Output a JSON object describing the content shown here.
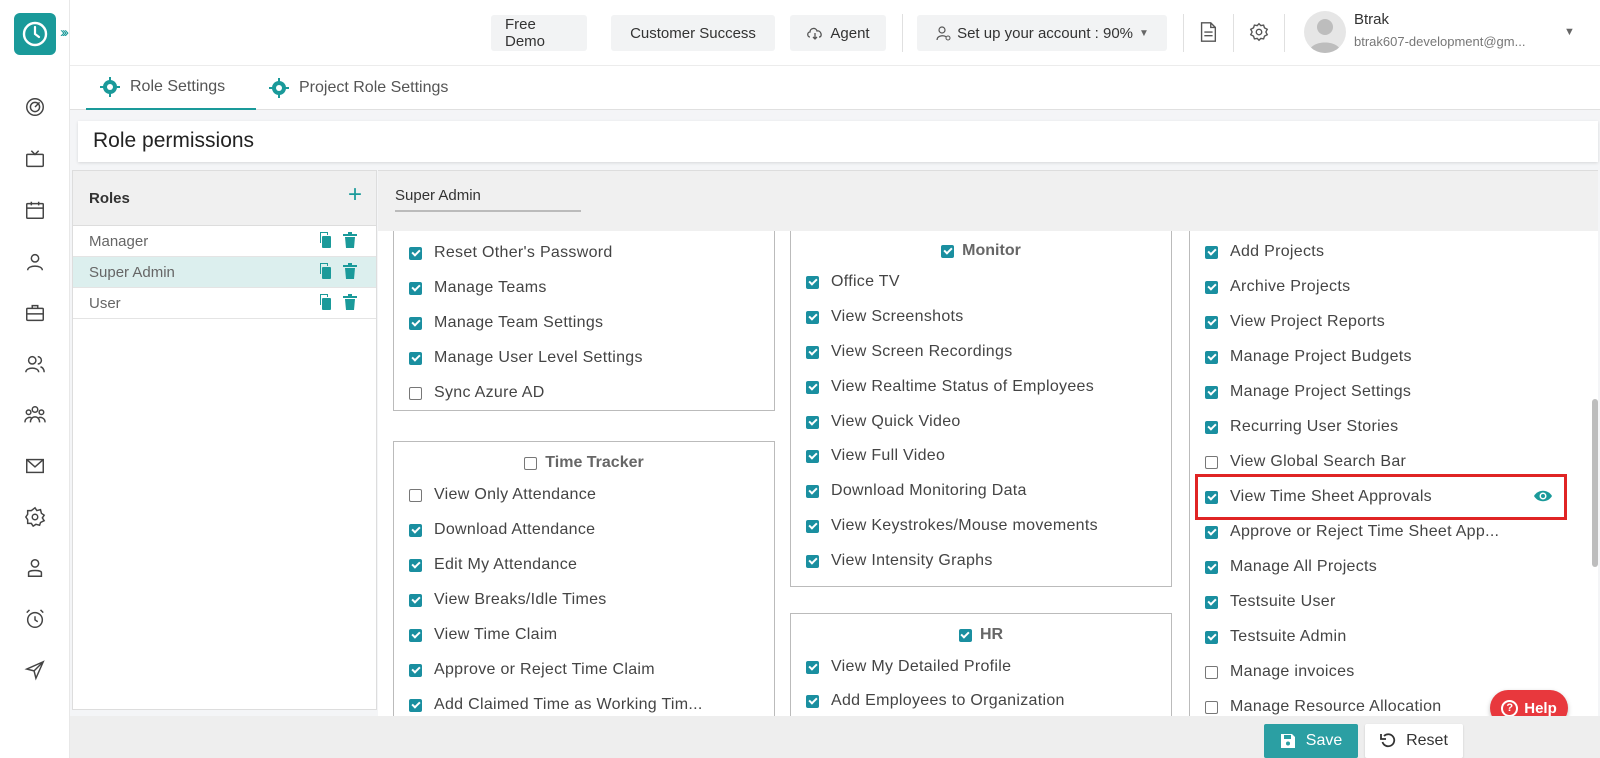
{
  "topbar": {
    "free_demo": "Free Demo",
    "customer_success": "Customer Success",
    "agent": "Agent",
    "setup": "Set up your account : 90%",
    "user_name": "Btrak",
    "user_email": "btrak607-development@gm..."
  },
  "tabs": {
    "role_settings": "Role Settings",
    "project_role_settings": "Project Role Settings"
  },
  "page_title": "Role permissions",
  "roles": {
    "header": "Roles",
    "items": [
      "Manager",
      "Super Admin",
      "User"
    ],
    "selected": "Super Admin"
  },
  "perm": {
    "role_name": "Super Admin",
    "col1_top": [
      {
        "label": "Reset Other's Password",
        "checked": true
      },
      {
        "label": "Manage Teams",
        "checked": true
      },
      {
        "label": "Manage Team Settings",
        "checked": true
      },
      {
        "label": "Manage User Level Settings",
        "checked": true
      },
      {
        "label": "Sync Azure AD",
        "checked": false
      }
    ],
    "time_tracker": {
      "title": "Time Tracker",
      "checked": false,
      "items": [
        {
          "label": "View Only Attendance",
          "checked": false
        },
        {
          "label": "Download Attendance",
          "checked": true
        },
        {
          "label": "Edit My Attendance",
          "checked": true
        },
        {
          "label": "View Breaks/Idle Times",
          "checked": true
        },
        {
          "label": "View Time Claim",
          "checked": true
        },
        {
          "label": "Approve or Reject Time Claim",
          "checked": true
        },
        {
          "label": "Add Claimed Time as Working Tim...",
          "checked": true
        }
      ]
    },
    "monitor": {
      "title": "Monitor",
      "checked": true,
      "items": [
        {
          "label": "Office TV",
          "checked": true
        },
        {
          "label": "View Screenshots",
          "checked": true
        },
        {
          "label": "View Screen Recordings",
          "checked": true
        },
        {
          "label": "View Realtime Status of Employees",
          "checked": true
        },
        {
          "label": "View Quick Video",
          "checked": true
        },
        {
          "label": "View Full Video",
          "checked": true
        },
        {
          "label": "Download Monitoring Data",
          "checked": true
        },
        {
          "label": "View Keystrokes/Mouse movements",
          "checked": true
        },
        {
          "label": "View Intensity Graphs",
          "checked": true
        }
      ]
    },
    "hr": {
      "title": "HR",
      "checked": true,
      "items": [
        {
          "label": "View My Detailed Profile",
          "checked": true
        },
        {
          "label": "Add Employees to Organization",
          "checked": true
        }
      ]
    },
    "col3": [
      {
        "label": "Add Projects",
        "checked": true
      },
      {
        "label": "Archive Projects",
        "checked": true
      },
      {
        "label": "View Project Reports",
        "checked": true
      },
      {
        "label": "Manage Project Budgets",
        "checked": true
      },
      {
        "label": "Manage Project Settings",
        "checked": true
      },
      {
        "label": "Recurring User Stories",
        "checked": true
      },
      {
        "label": "View Global Search Bar",
        "checked": false
      },
      {
        "label": "View Time Sheet Approvals",
        "checked": true
      },
      {
        "label": "Approve or Reject Time Sheet App...",
        "checked": true
      },
      {
        "label": "Manage All Projects",
        "checked": true
      },
      {
        "label": "Testsuite User",
        "checked": true
      },
      {
        "label": "Testsuite Admin",
        "checked": true
      },
      {
        "label": "Manage invoices",
        "checked": false
      },
      {
        "label": "Manage Resource Allocation",
        "checked": false
      }
    ]
  },
  "help": "Help",
  "footer": {
    "save": "Save",
    "reset": "Reset"
  },
  "colors": {
    "accent": "#1a9a9a",
    "checkbox": "#1a8fa0",
    "highlight": "#e02424",
    "help": "#e8383d"
  }
}
